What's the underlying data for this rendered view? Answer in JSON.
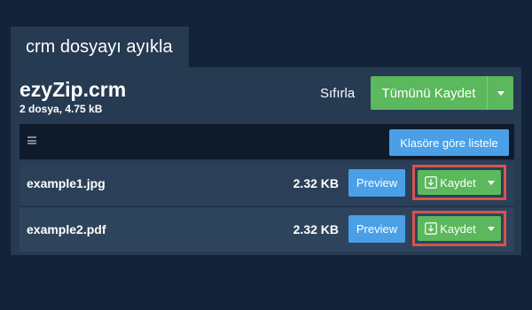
{
  "tab": {
    "label": "crm dosyayı ayıkla"
  },
  "archive": {
    "name": "ezyZip.crm",
    "meta": "2 dosya, 4.75 kB"
  },
  "actions": {
    "reset_label": "Sıfırla",
    "save_all_label": "Tümünü Kaydet"
  },
  "toolbar": {
    "menu_icon": "hamburger-icon",
    "list_button_label": "Klasöre göre listele"
  },
  "files": [
    {
      "name": "example1.jpg",
      "size": "2.32 KB",
      "preview_label": "Preview",
      "save_label": "Kaydet",
      "highlighted": true
    },
    {
      "name": "example2.pdf",
      "size": "2.32 KB",
      "preview_label": "Preview",
      "save_label": "Kaydet",
      "highlighted": true
    }
  ],
  "colors": {
    "background": "#13233a",
    "panel": "#263a52",
    "success": "#5cb85c",
    "primary": "#4a9fe6",
    "highlight": "#d9534f"
  }
}
